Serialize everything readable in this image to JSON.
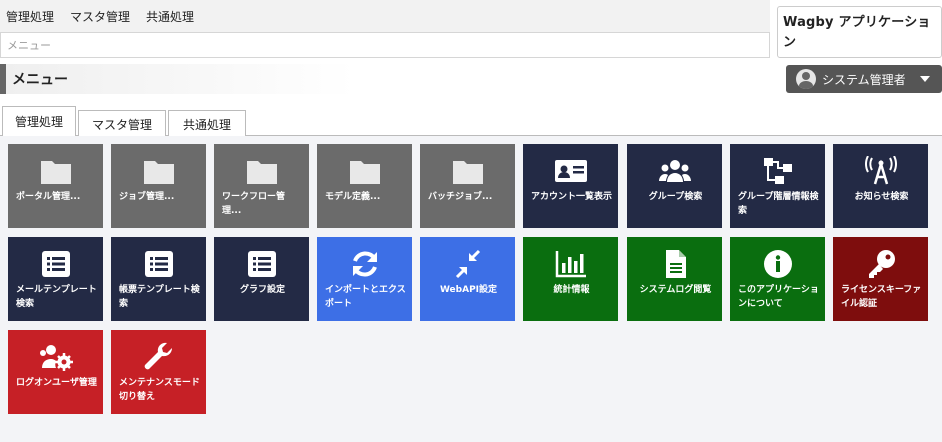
{
  "topnav": {
    "items": [
      "管理処理",
      "マスタ管理",
      "共通処理"
    ]
  },
  "search": {
    "placeholder": "メニュー"
  },
  "app": {
    "name": "Wagby アプリケーション"
  },
  "menubar": {
    "title": "メニュー"
  },
  "user": {
    "label": "システム管理者"
  },
  "tabs": [
    "管理処理",
    "マスタ管理",
    "共通処理"
  ],
  "tiles": [
    {
      "label": "ポータル管理...",
      "icon": "folder-icon",
      "color": "gray"
    },
    {
      "label": "ジョブ管理...",
      "icon": "folder-icon",
      "color": "gray"
    },
    {
      "label": "ワークフロー管理...",
      "icon": "folder-icon",
      "color": "gray"
    },
    {
      "label": "モデル定義...",
      "icon": "folder-icon",
      "color": "gray"
    },
    {
      "label": "バッチジョブ...",
      "icon": "folder-icon",
      "color": "gray"
    },
    {
      "label": "アカウント一覧表示",
      "icon": "id-card-icon",
      "color": "navy"
    },
    {
      "label": "グループ検索",
      "icon": "users-icon",
      "color": "navy"
    },
    {
      "label": "グループ階層情報検索",
      "icon": "sitemap-icon",
      "color": "navy"
    },
    {
      "label": "お知らせ検索",
      "icon": "broadcast-icon",
      "color": "navy"
    },
    {
      "label": "メールテンプレート検索",
      "icon": "list-icon",
      "color": "navy"
    },
    {
      "label": "帳票テンプレート検索",
      "icon": "list-icon",
      "color": "navy"
    },
    {
      "label": "グラフ設定",
      "icon": "list-icon",
      "color": "navy"
    },
    {
      "label": "インポートとエクスポート",
      "icon": "sync-icon",
      "color": "blue"
    },
    {
      "label": "WebAPI設定",
      "icon": "compress-icon",
      "color": "blue"
    },
    {
      "label": "統計情報",
      "icon": "bar-chart-icon",
      "color": "green"
    },
    {
      "label": "システムログ閲覧",
      "icon": "file-text-icon",
      "color": "green"
    },
    {
      "label": "このアプリケーションについて",
      "icon": "info-icon",
      "color": "green"
    },
    {
      "label": "ライセンスキーファイル認証",
      "icon": "key-icon",
      "color": "maroon"
    },
    {
      "label": "ログオンユーザ管理",
      "icon": "users-cog-icon",
      "color": "red"
    },
    {
      "label": "メンテナンスモード切り替え",
      "icon": "wrench-icon",
      "color": "red"
    }
  ]
}
